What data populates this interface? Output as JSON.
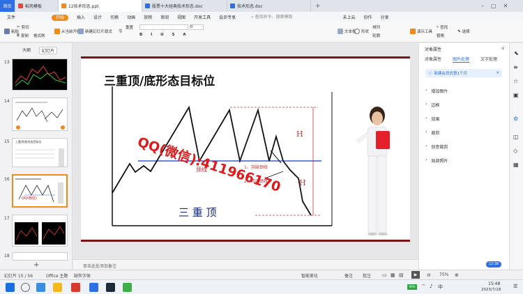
{
  "tabs": [
    {
      "label": "首页",
      "type": "home"
    },
    {
      "label": "稻壳模板",
      "type": "normal",
      "color": "#e8473a"
    },
    {
      "label": "12技术形态.ppt",
      "type": "active",
      "color": "#f08a1a"
    },
    {
      "label": "股票十大经典技术形态.doc",
      "type": "normal",
      "color": "#2f6fe4"
    },
    {
      "label": "技术形态.doc",
      "type": "normal",
      "color": "#2f6fe4"
    }
  ],
  "menu": {
    "file": "文件",
    "items": [
      "开始",
      "插入",
      "设计",
      "切换",
      "动画",
      "放映",
      "审阅",
      "视图",
      "开发工具",
      "会员专享"
    ],
    "search_placeholder": "查找命令、搜索模板",
    "cloud": "未上云",
    "collab": "协作",
    "share": "分享"
  },
  "toolbar": {
    "items": [
      "粘贴",
      "剪切",
      "复制",
      "格式刷",
      "从当前开始",
      "新建幻灯片",
      "版式",
      "节",
      "重置",
      "文本框",
      "形状",
      "排列",
      "轮廓",
      "演示工具",
      "查找",
      "替换",
      "选择"
    ],
    "font_name": "",
    "font_size": "0"
  },
  "left_panel": {
    "tab_outline": "大纲",
    "tab_slides": "幻灯片",
    "slide_numbers": [
      "13",
      "14",
      "15",
      "16",
      "17",
      "18"
    ],
    "slide15_title": "三重顶/底形态目标位"
  },
  "slide": {
    "title": "三重顶/底形态目标位",
    "label_h1": "H",
    "label_h2": "H",
    "neckline": "颈线",
    "annotation1": "1、突破颈线",
    "annotation2": "2、回调颈线",
    "bottom_text": "三 重 顶",
    "watermark": "QQ(微信):411966170"
  },
  "notes_placeholder": "单击此处添加备注",
  "right_panel": {
    "tabs": [
      "对象属性",
      "图片处理",
      "文字处理"
    ],
    "active_tab": "图片处理",
    "notice": "新建会员优惠1个月",
    "sections": [
      "增加图片",
      "边框",
      "效果",
      "裁剪",
      "创意裁剪",
      "局部照片"
    ]
  },
  "status": {
    "slide_info": "幻灯片 15 / 56",
    "theme": "Office 主题",
    "font_missing": "缺失字体",
    "smart": "智能美化",
    "notes": "备注",
    "comments": "批注",
    "zoom": "75%",
    "time_badge": "22:38"
  },
  "taskbar": {
    "time": "15:48",
    "date": "2023/7/18",
    "battery": "99%"
  },
  "colors": {
    "accent": "#f08a1a",
    "blue": "#2f6fe4",
    "slide_border": "#7a1515",
    "watermark": "#e0191b"
  }
}
